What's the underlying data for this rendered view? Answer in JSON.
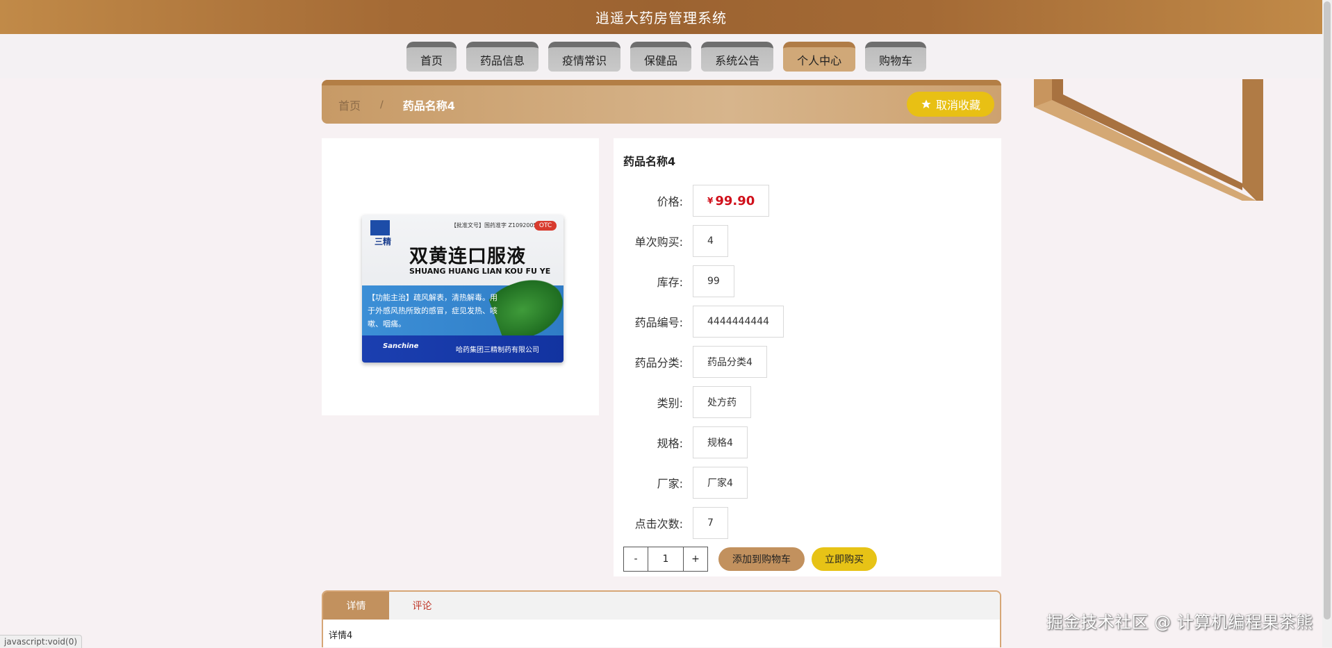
{
  "header": {
    "title": "逍遥大药房管理系统"
  },
  "nav": [
    {
      "label": "首页",
      "active": false
    },
    {
      "label": "药品信息",
      "active": false
    },
    {
      "label": "疫情常识",
      "active": false
    },
    {
      "label": "保健品",
      "active": false
    },
    {
      "label": "系统公告",
      "active": false
    },
    {
      "label": "个人中心",
      "active": true
    },
    {
      "label": "购物车",
      "active": false
    }
  ],
  "breadcrumb": {
    "home": "首页",
    "separator": "/",
    "current": "药品名称4"
  },
  "favorite": {
    "label": "取消收藏",
    "icon": "star-icon"
  },
  "product": {
    "name": "药品名称4",
    "currency": "¥",
    "price": "99.90",
    "fields": [
      {
        "label": "价格:",
        "value": "99.90"
      },
      {
        "label": "单次购买:",
        "value": "4"
      },
      {
        "label": "库存:",
        "value": "99"
      },
      {
        "label": "药品编号:",
        "value": "4444444444"
      },
      {
        "label": "药品分类:",
        "value": "药品分类4"
      },
      {
        "label": "类别:",
        "value": "处方药"
      },
      {
        "label": "规格:",
        "value": "规格4"
      },
      {
        "label": "厂家:",
        "value": "厂家4"
      },
      {
        "label": "点击次数:",
        "value": "7"
      }
    ]
  },
  "image": {
    "brand": "三精",
    "approval": "【批准文号】国药准字 Z10920053",
    "otc": "OTC",
    "name": "双黄连口服液",
    "pinyin": "SHUANG HUANG LIAN KOU FU YE",
    "description": "【功能主治】疏风解表，清热解毒。用于外感风热所致的感冒，症见发热、咳嗽、咽痛。",
    "sanchine": "Sanchine",
    "company": "哈药集团三精制药有限公司"
  },
  "quantity": {
    "minus": "-",
    "value": "1",
    "plus": "+"
  },
  "actions": {
    "add_to_cart": "添加到购物车",
    "buy_now": "立即购买"
  },
  "tabs": [
    {
      "label": "详情",
      "active": true
    },
    {
      "label": "评论",
      "active": false
    }
  ],
  "tab_content": "详情4",
  "watermark": "掘金技术社区 @ 计算机编程果茶熊",
  "status_bar": "javascript:void(0)"
}
